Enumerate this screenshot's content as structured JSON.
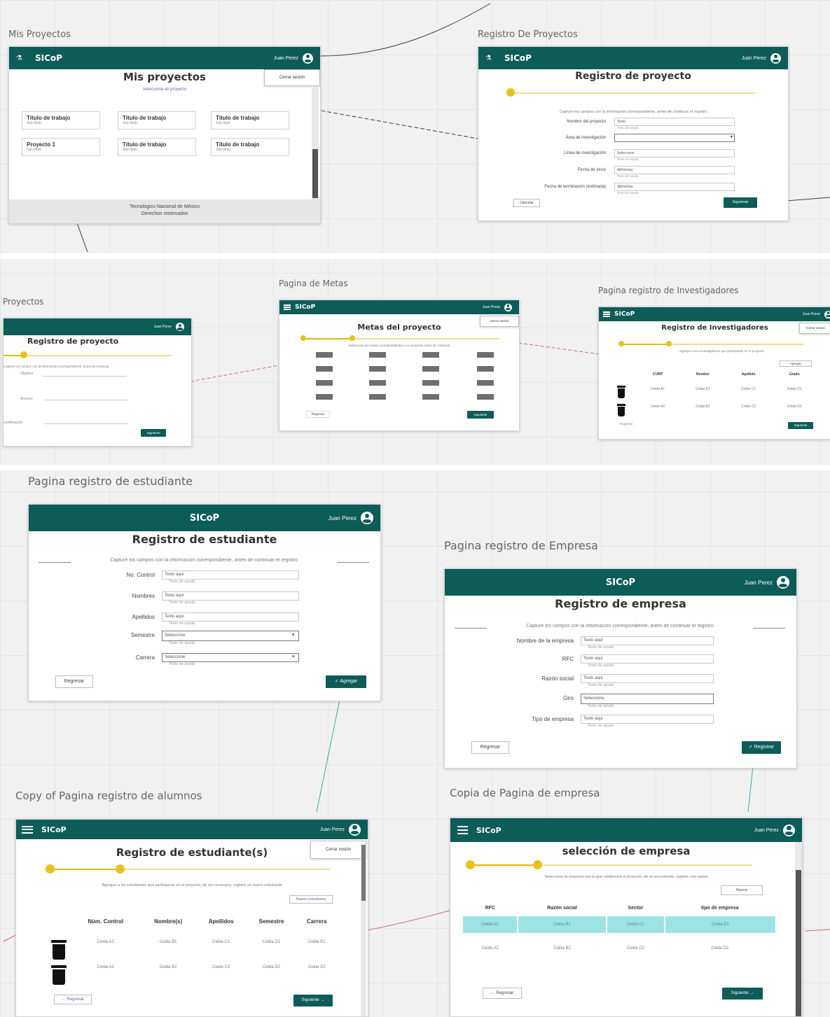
{
  "brand": "SICoP",
  "user_name": "Juan Perez",
  "frames": {
    "mis_proyectos": {
      "label": "Mis Proyectos",
      "title": "Mis proyectos",
      "subtitle": "Selecciona un proyecto",
      "dropdown": "Cerrar sesión",
      "cards": [
        {
          "title": "Título de trabajo",
          "sub": "Sub titulo"
        },
        {
          "title": "Título de trabajo",
          "sub": "Sub titulo"
        },
        {
          "title": "Título de trabajo",
          "sub": "Sub titulo"
        },
        {
          "title": "Proyecto 1",
          "sub": "Sub titulo"
        },
        {
          "title": "Título de trabajo",
          "sub": "Sub titulo"
        },
        {
          "title": "Título de trabajo",
          "sub": "Sub titulo"
        }
      ],
      "footer_line1": "Tecnológico Nacional de México",
      "footer_line2": "Derechos reservados"
    },
    "registro_proyectos": {
      "label": "Registro De Proyectos",
      "title": "Registro de proyecto",
      "instructions": "Capture los campos con la información correspondiente, antes de continuar el registro",
      "fields": [
        {
          "label": "Nombre del proyecto",
          "value": "Texto",
          "help": "Texto de ayuda"
        },
        {
          "label": "Área de investigación",
          "value": "",
          "help": ""
        },
        {
          "label": "Línea de investigación",
          "value": "Seleccione",
          "help": "Texto de ayuda"
        },
        {
          "label": "Fecha de inicio",
          "value": "dd/mm/aa",
          "help": "Texto de ayuda"
        },
        {
          "label": "Fecha de terminación (estimada)",
          "value": "dd/mm/aa",
          "help": "Texto de ayuda"
        }
      ],
      "back": "Cancelar",
      "next": "Siguiente"
    },
    "proyectos_partial": {
      "label": "Proyectos",
      "title": "Registro de proyecto",
      "instructions": "Capture los campos con la información correspondiente, antes de continuar",
      "field_labels": [
        "Objetivo",
        "Alcance",
        "Justificación"
      ],
      "next": "Siguiente"
    },
    "metas": {
      "label": "Pagina de Metas",
      "title": "Metas del proyecto",
      "instructions": "Seleccione las metas correspondientes a su proyecto antes de continuar",
      "dropdown": "Cerrar sesión",
      "back": "Regresar",
      "next": "Siguiente"
    },
    "investigadores": {
      "label": "Pagina registro de Investigadores",
      "title": "Registro de Investigadores",
      "instructions": "Agregue a los investigadores que participarán en el proyecto",
      "add_button": "Agregar",
      "dropdown": "Cerrar sesión",
      "columns": [
        "CURP",
        "Nombre",
        "Apellido",
        "Grado"
      ],
      "rows": [
        [
          "Celda A1",
          "Celda B1",
          "Celda C1",
          "Celda D1"
        ],
        [
          "Celda A2",
          "Celda B2",
          "Celda C2",
          "Celda D2"
        ]
      ],
      "back": "Regresar",
      "next": "Siguiente"
    },
    "estudiante": {
      "label": "Pagina registro de estudiante",
      "title": "Registro de estudiante",
      "instructions": "Capture los campos con la información correspondiente, antes de continuar el registro",
      "fields": [
        {
          "label": "No. Control",
          "value": "Texto aquí",
          "help": "Texto de ayuda"
        },
        {
          "label": "Nombres",
          "value": "Texto aquí",
          "help": "Texto de ayuda"
        },
        {
          "label": "Apellidos",
          "value": "Texto aquí",
          "help": "Texto de ayuda"
        },
        {
          "label": "Semestre",
          "value": "Seleccione",
          "help": "Texto de ayuda"
        },
        {
          "label": "Carrera",
          "value": "Seleccione",
          "help": "Texto de ayuda"
        }
      ],
      "back": "Regresar",
      "next": "✓ Agregar"
    },
    "empresa": {
      "label": "Pagina registro de Empresa",
      "title": "Registro de empresa",
      "instructions": "Capture los campos con la información correspondiente, antes de continuar el registro",
      "fields": [
        {
          "label": "Nombre de la empresa",
          "value": "Texto aquí",
          "help": "Texto de ayuda"
        },
        {
          "label": "RFC",
          "value": "Texto aquí",
          "help": "Texto de ayuda"
        },
        {
          "label": "Razón social",
          "value": "Texto aquí",
          "help": "Texto de ayuda"
        },
        {
          "label": "Giro",
          "value": "Seleccione",
          "help": "Texto de ayuda"
        },
        {
          "label": "Tipo de empresa",
          "value": "Texto aquí",
          "help": "Texto de ayuda"
        }
      ],
      "back": "Regresar",
      "next": "✓ Registrar"
    },
    "alumnos": {
      "label": "Copy of Pagina registro de alumnos",
      "title": "Registro de estudiante(s)",
      "instructions": "Agregue a los estudiantes que participarán en el proyecto, de ser necesario, registre un nuevo estudiante",
      "add_button": "Nuevo estudiante",
      "dropdown": "Cerrar sesión",
      "columns": [
        "Núm. Control",
        "Nombre(s)",
        "Apellidos",
        "Semestre",
        "Carrera"
      ],
      "rows": [
        [
          "Celda A1",
          "Celda B1",
          "Celda C1",
          "Celda D1",
          "Celda E1"
        ],
        [
          "Celda A2",
          "Celda B2",
          "Celda C2",
          "Celda D2",
          "Celda E2"
        ]
      ],
      "back": "← Regresar",
      "next": "Siguiente →"
    },
    "seleccion_empresa": {
      "label": "Copia de Pagina de empresa",
      "title": "selección de empresa",
      "instructions": "Seleccione la empresa con la que colaborará el proyecto, de no encontrarla, registre una nueva",
      "add_button": "Nueva",
      "columns": [
        "RFC",
        "Razón social",
        "Sector",
        "tipo de empresa"
      ],
      "rows": [
        [
          "Celda A1",
          "Celda B1",
          "Celda C1",
          "Celda D1"
        ],
        [
          "Celda A2",
          "Celda B2",
          "Celda C2",
          "Celda D2"
        ]
      ],
      "back": "← Regresar",
      "next": "Siguiente →"
    }
  },
  "colors": {
    "app_bar": "#0d5c57",
    "progress": "#e6c21a",
    "highlight_row": "#9ee3e3"
  }
}
